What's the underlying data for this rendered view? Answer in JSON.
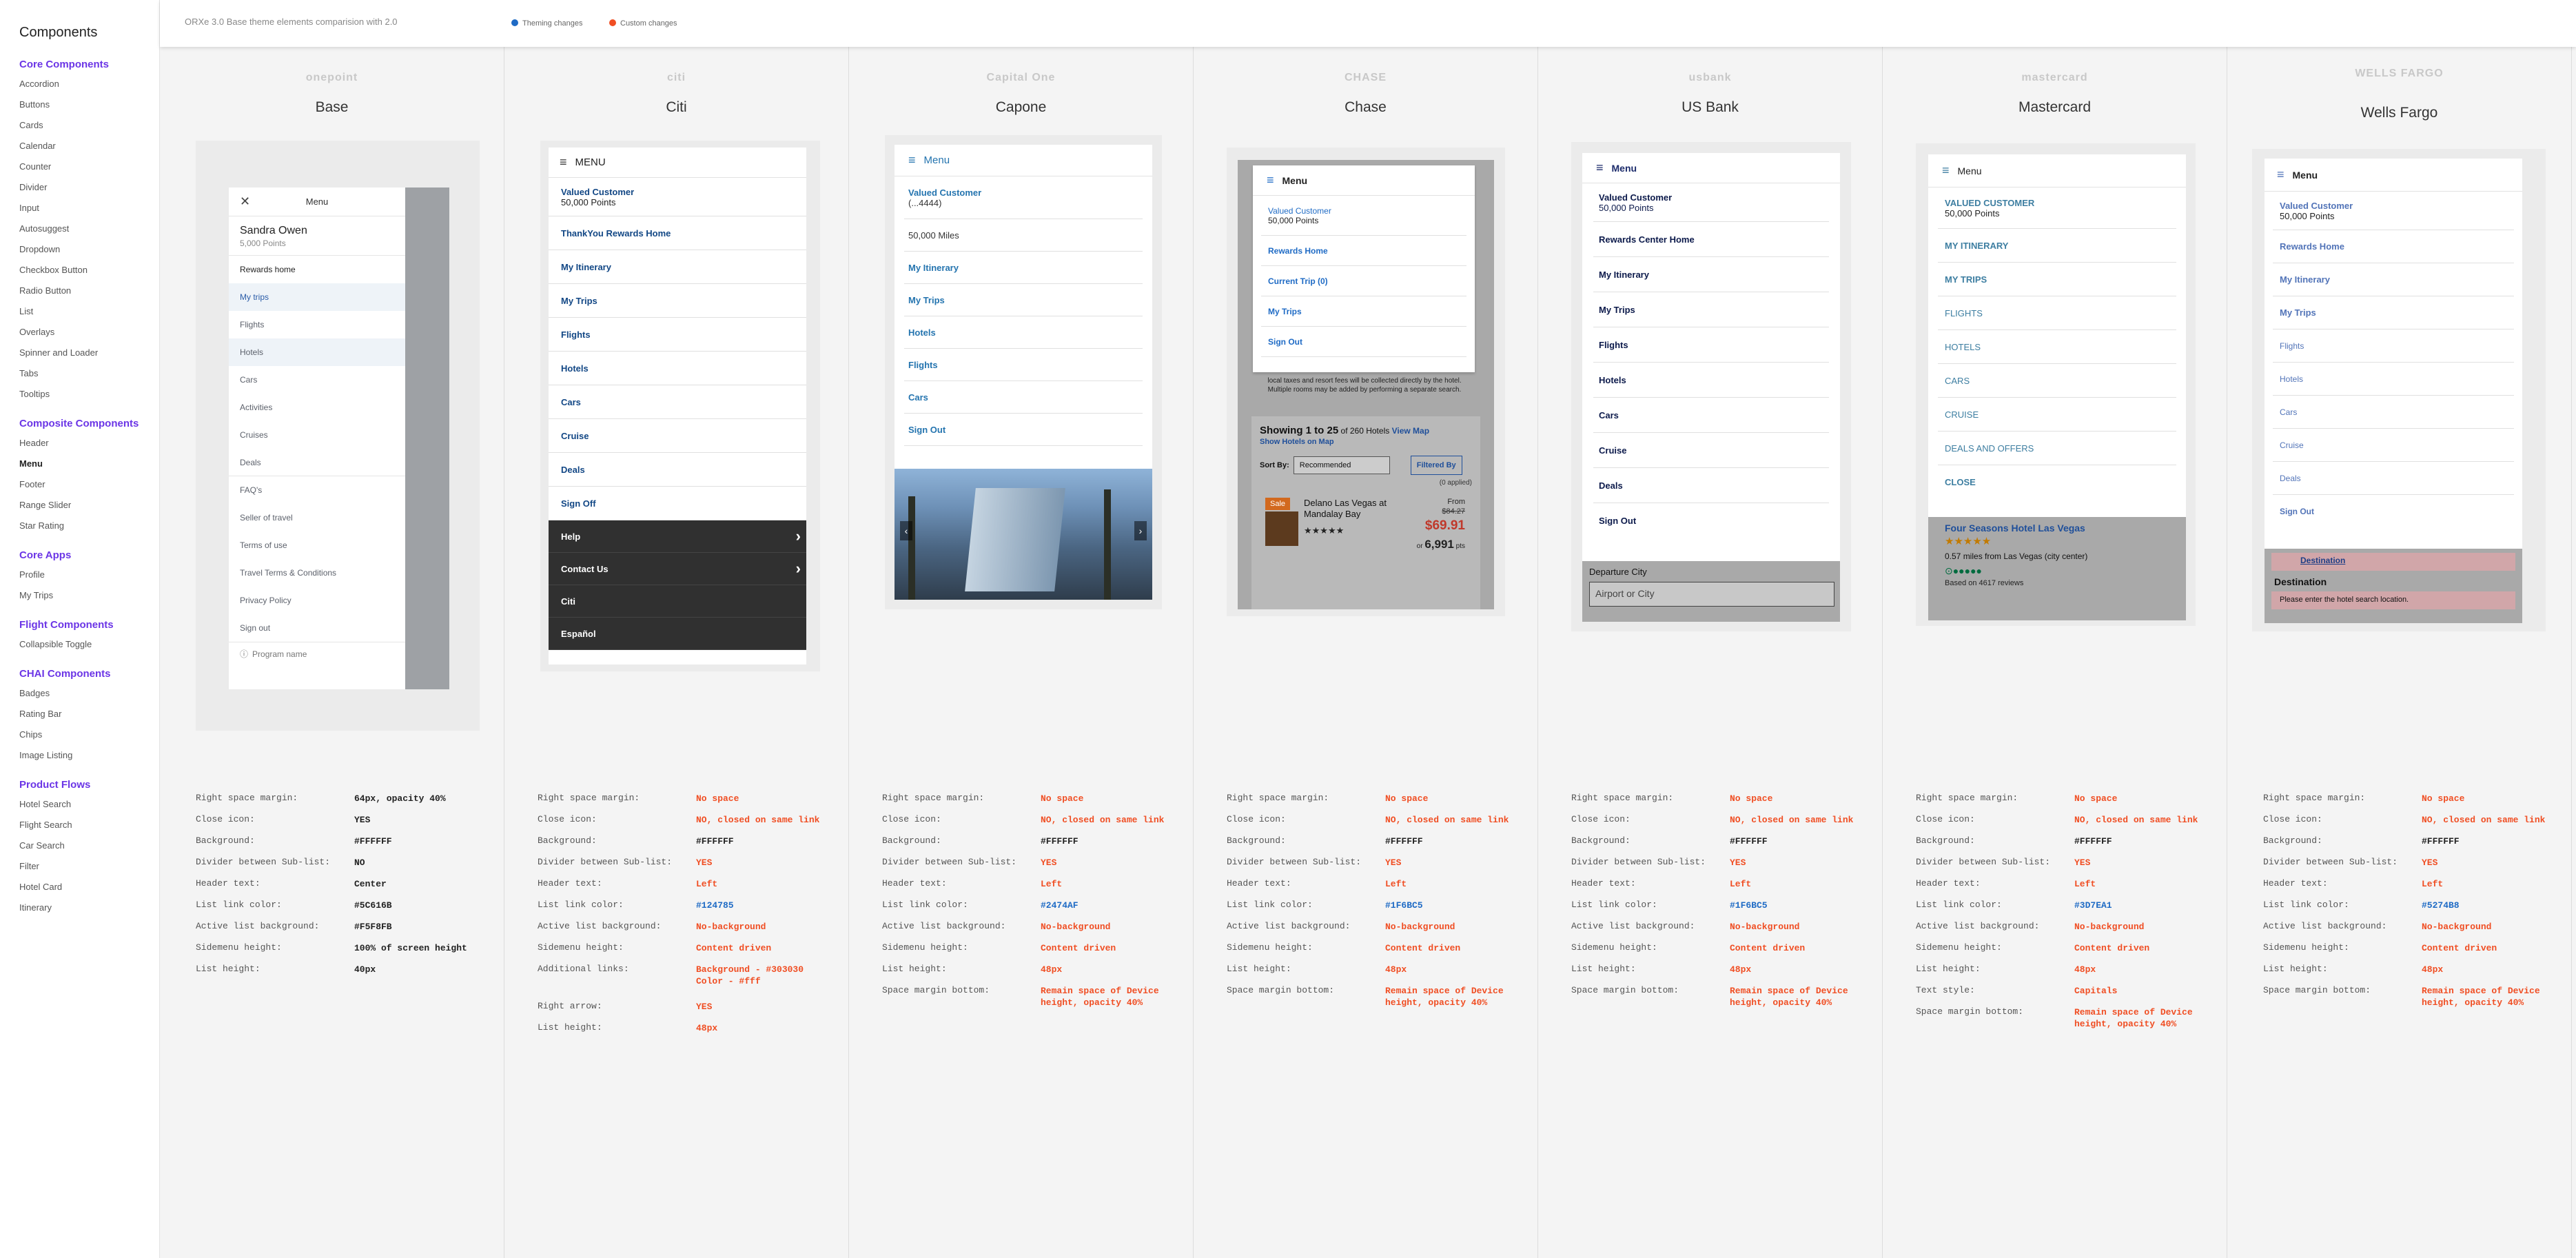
{
  "sidebar": {
    "title": "Components",
    "sections": [
      {
        "label": "Core Components",
        "items": [
          "Accordion",
          "Buttons",
          "Cards",
          "Calendar",
          "Counter",
          "Divider",
          "Input",
          "Autosuggest",
          "Dropdown",
          "Checkbox Button",
          "Radio Button",
          "List",
          "Overlays",
          "Spinner and Loader",
          "Tabs",
          "Tooltips"
        ]
      },
      {
        "label": "Composite Components",
        "items": [
          "Header",
          "Menu",
          "Footer",
          "Range Slider",
          "Star Rating"
        ]
      },
      {
        "label": "Core Apps",
        "items": [
          "Profile",
          "My Trips"
        ]
      },
      {
        "label": "Flight Components",
        "items": [
          "Collapsible Toggle"
        ]
      },
      {
        "label": "CHAI Components",
        "items": [
          "Badges",
          "Rating Bar",
          "Chips",
          "Image Listing"
        ]
      },
      {
        "label": "Product Flows",
        "items": [
          "Hotel Search",
          "Flight Search",
          "Car Search",
          "Filter",
          "Hotel Card",
          "Itinerary"
        ]
      }
    ],
    "active_item": "Menu"
  },
  "header": {
    "title": "ORXe 3.0 Base theme elements comparision with 2.0",
    "legend": [
      {
        "label": "Theming changes",
        "color": "#1f6bc5"
      },
      {
        "label": "Custom changes",
        "color": "#f04e23"
      }
    ]
  },
  "columns": [
    {
      "brand": "Base",
      "logo": "onepoint",
      "menu": {
        "header": "Menu",
        "close_icon": "close-icon",
        "user_name": "Sandra Owen",
        "points": "5,000 Points",
        "items": [
          "Rewards home",
          "My trips",
          "Flights",
          "Hotels",
          "Cars",
          "Activities",
          "Cruises",
          "Deals",
          "FAQ's",
          "Seller of travel",
          "Terms of use",
          "Travel Terms & Conditions",
          "Privacy Policy",
          "Sign out"
        ],
        "footer": "Program name"
      },
      "specs": [
        [
          "Right space margin:",
          "64px, opacity 40%",
          "normal"
        ],
        [
          "Close icon:",
          "YES",
          "normal"
        ],
        [
          "Background:",
          "#FFFFFF",
          "normal"
        ],
        [
          "Divider between Sub-list:",
          "NO",
          "normal"
        ],
        [
          "Header text:",
          "Center",
          "normal"
        ],
        [
          "List link color:",
          "#5C616B",
          "normal"
        ],
        [
          "Active list background:",
          "#F5F8FB",
          "normal"
        ],
        [
          "Sidemenu height:",
          "100% of screen height",
          "normal"
        ],
        [
          "List height:",
          "40px",
          "normal"
        ]
      ]
    },
    {
      "brand": "Citi",
      "logo": "citi",
      "menu": {
        "header": "MENU",
        "items": [
          "Valued Customer\n50,000 Points",
          "ThankYou Rewards Home",
          "My Itinerary",
          "My Trips",
          "Flights",
          "Hotels",
          "Cars",
          "Cruise",
          "Deals",
          "Sign Off"
        ],
        "dark_items": [
          "Help",
          "Contact Us",
          "Citi",
          "Español"
        ]
      },
      "specs": [
        [
          "Right space margin:",
          "No space",
          "red"
        ],
        [
          "Close icon:",
          "NO, closed on same link",
          "red"
        ],
        [
          "Background:",
          "#FFFFFF",
          "normal"
        ],
        [
          "Divider between Sub-list:",
          "YES",
          "red"
        ],
        [
          "Header text:",
          "Left",
          "red"
        ],
        [
          "List link color:",
          "#124785",
          "blue"
        ],
        [
          "Active list background:",
          "No-background",
          "red"
        ],
        [
          "Sidemenu height:",
          "Content driven",
          "red"
        ],
        [
          "Additional links:",
          "Background - #303030\nColor - #fff",
          "red"
        ],
        [
          "Right arrow:",
          "YES",
          "red"
        ],
        [
          "List height:",
          "48px",
          "red"
        ]
      ]
    },
    {
      "brand": "Capone",
      "logo": "Capital One",
      "menu": {
        "header": "Menu",
        "items": [
          "Valued Customer\n(...4444)",
          "50,000 Miles",
          "My Itinerary",
          "My Trips",
          "Hotels",
          "Flights",
          "Cars",
          "Sign Out"
        ]
      },
      "specs": [
        [
          "Right space margin:",
          "No space",
          "red"
        ],
        [
          "Close icon:",
          "NO, closed on same link",
          "red"
        ],
        [
          "Background:",
          "#FFFFFF",
          "normal"
        ],
        [
          "Divider between Sub-list:",
          "YES",
          "red"
        ],
        [
          "Header text:",
          "Left",
          "red"
        ],
        [
          "List link color:",
          "#2474AF",
          "blue"
        ],
        [
          "Active list background:",
          "No-background",
          "red"
        ],
        [
          "Sidemenu height:",
          "Content driven",
          "red"
        ],
        [
          "List height:",
          "48px",
          "red"
        ],
        [
          "Space margin bottom:",
          "Remain space of Device\nheight, opacity 40%",
          "red"
        ]
      ]
    },
    {
      "brand": "Chase",
      "logo": "CHASE",
      "menu": {
        "header": "Menu",
        "items": [
          "Valued Customer\n50,000 Points",
          "Rewards Home",
          "Current Trip (0)",
          "My Trips",
          "Sign Out"
        ],
        "bg_text": "local taxes and resort fees will be collected directly by the hotel. Multiple rooms may be added by performing a separate search.",
        "showing": "Showing 1 to 25",
        "of_hotels": "of 260 Hotels",
        "view_map": "View Map",
        "show_hotels": "Show Hotels on Map",
        "sort_label": "Sort By:",
        "sort_value": "Recommended",
        "filtered": "Filtered By",
        "applied": "(0 applied)",
        "sale": "Sale",
        "hotel_name": "Delano Las Vegas at Mandalay Bay",
        "from": "From",
        "old_price": "$84.27",
        "price": "$69.91",
        "points": "6,991",
        "points_prefix": "or",
        "points_suffix": "pts"
      },
      "specs": [
        [
          "Right space margin:",
          "No space",
          "red"
        ],
        [
          "Close icon:",
          "NO, closed on same link",
          "red"
        ],
        [
          "Background:",
          "#FFFFFF",
          "normal"
        ],
        [
          "Divider between Sub-list:",
          "YES",
          "red"
        ],
        [
          "Header text:",
          "Left",
          "red"
        ],
        [
          "List link color:",
          "#1F6BC5",
          "blue"
        ],
        [
          "Active list background:",
          "No-background",
          "red"
        ],
        [
          "Sidemenu height:",
          "Content driven",
          "red"
        ],
        [
          "List height:",
          "48px",
          "red"
        ],
        [
          "Space margin bottom:",
          "Remain space of Device\nheight, opacity 40%",
          "red"
        ]
      ]
    },
    {
      "brand": "US Bank",
      "logo": "usbank",
      "menu": {
        "header": "Menu",
        "items": [
          "Valued Customer\n50,000 Points",
          "Rewards Center Home",
          "My Itinerary",
          "My Trips",
          "Flights",
          "Hotels",
          "Cars",
          "Cruise",
          "Deals",
          "Sign Out"
        ],
        "departure_label": "Departure City",
        "departure_placeholder": "Airport or City"
      },
      "specs": [
        [
          "Right space margin:",
          "No space",
          "red"
        ],
        [
          "Close icon:",
          "NO, closed on same link",
          "red"
        ],
        [
          "Background:",
          "#FFFFFF",
          "normal"
        ],
        [
          "Divider between Sub-list:",
          "YES",
          "red"
        ],
        [
          "Header text:",
          "Left",
          "red"
        ],
        [
          "List link color:",
          "#1F6BC5",
          "blue"
        ],
        [
          "Active list background:",
          "No-background",
          "red"
        ],
        [
          "Sidemenu height:",
          "Content driven",
          "red"
        ],
        [
          "List height:",
          "48px",
          "red"
        ],
        [
          "Space margin bottom:",
          "Remain space of Device\nheight, opacity 40%",
          "red"
        ]
      ]
    },
    {
      "brand": "Mastercard",
      "logo": "mastercard",
      "menu": {
        "header": "Menu",
        "items": [
          "VALUED CUSTOMER\n50,000 Points",
          "MY ITINERARY",
          "MY TRIPS",
          "FLIGHTS",
          "HOTELS",
          "CARS",
          "CRUISE",
          "DEALS AND OFFERS",
          "CLOSE"
        ],
        "hotel_name": "Four Seasons Hotel Las Vegas",
        "distance": "0.57 miles from Las Vegas (city center)",
        "reviews": "Based on 4617 reviews"
      },
      "specs": [
        [
          "Right space margin:",
          "No space",
          "red"
        ],
        [
          "Close icon:",
          "NO, closed on same link",
          "red"
        ],
        [
          "Background:",
          "#FFFFFF",
          "normal"
        ],
        [
          "Divider between Sub-list:",
          "YES",
          "red"
        ],
        [
          "Header text:",
          "Left",
          "red"
        ],
        [
          "List link color:",
          "#3D7EA1",
          "blue"
        ],
        [
          "Active list background:",
          "No-background",
          "red"
        ],
        [
          "Sidemenu height:",
          "Content driven",
          "red"
        ],
        [
          "List height:",
          "48px",
          "red"
        ],
        [
          "Text style:",
          "Capitals",
          "red"
        ],
        [
          "Space margin bottom:",
          "Remain space of Device\nheight, opacity 40%",
          "red"
        ]
      ]
    },
    {
      "brand": "Wells Fargo",
      "logo": "WELLS FARGO",
      "menu": {
        "header": "Menu",
        "items": [
          "Valued Customer\n50,000 Points",
          "Rewards Home",
          "My Itinerary",
          "My Trips",
          "Flights",
          "Hotels",
          "Cars",
          "Cruise",
          "Deals",
          "Sign Out"
        ],
        "dest_link": "Destination",
        "dest_label": "Destination",
        "dest_error": "Please enter the hotel search location."
      },
      "specs": [
        [
          "Right space margin:",
          "No space",
          "red"
        ],
        [
          "Close icon:",
          "NO, closed on same link",
          "red"
        ],
        [
          "Background:",
          "#FFFFFF",
          "normal"
        ],
        [
          "Divider between Sub-list:",
          "YES",
          "red"
        ],
        [
          "Header text:",
          "Left",
          "red"
        ],
        [
          "List link color:",
          "#5274B8",
          "blue"
        ],
        [
          "Active list background:",
          "No-background",
          "red"
        ],
        [
          "Sidemenu height:",
          "Content driven",
          "red"
        ],
        [
          "List height:",
          "48px",
          "red"
        ],
        [
          "Space margin bottom:",
          "Remain space of Device\nheight, opacity 40%",
          "red"
        ]
      ]
    }
  ]
}
